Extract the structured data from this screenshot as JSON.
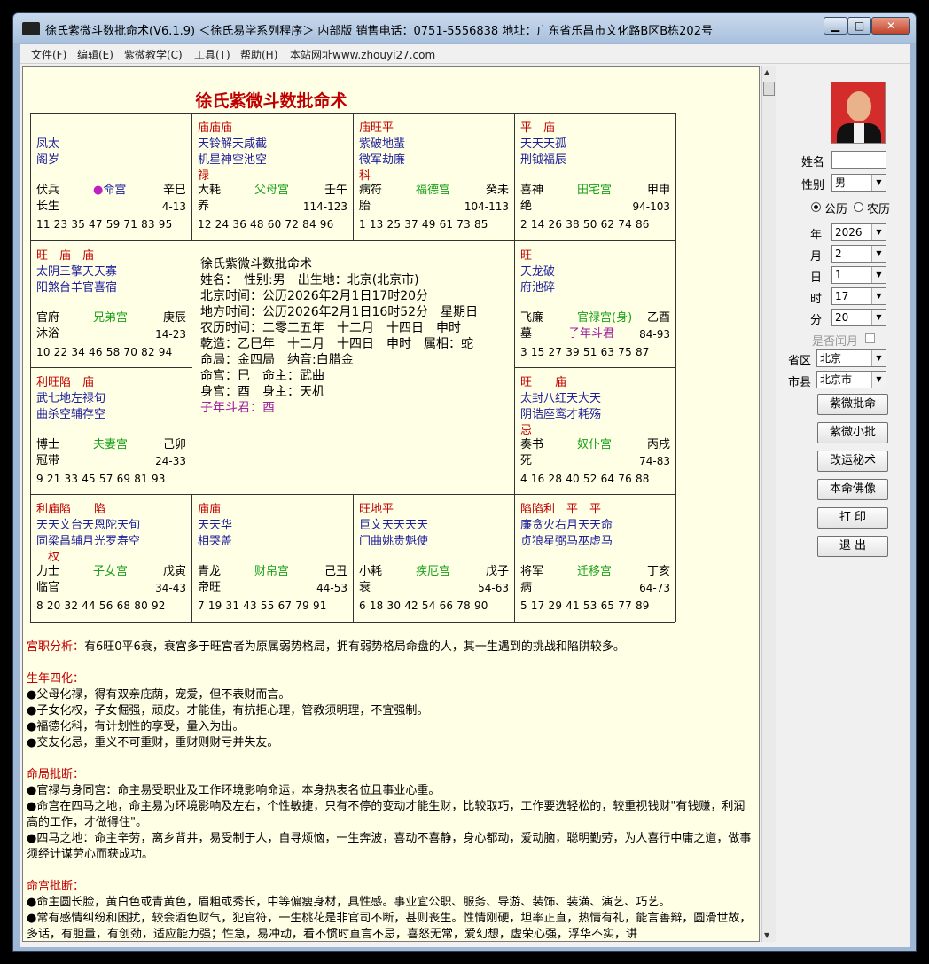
{
  "window": {
    "title": "徐氏紫微斗数批命术(V6.1.9) ＜徐氏易学系列程序＞ 内部版 销售电话：0751-5556838 地址：广东省乐昌市文化路B区B栋202号",
    "min": "▁",
    "max": "□",
    "close": "✕"
  },
  "menu": [
    "文件(F)",
    "编辑(E)",
    "紫微教学(C)",
    "工具(T)",
    "帮助(H)",
    "本站网址www.zhouyi27.com"
  ],
  "chart_title": "徐氏紫微斗数批命术",
  "cells": [
    {
      "id": "si",
      "lines": [
        "",
        "凤太",
        "阁岁",
        ""
      ],
      "god": "伏兵",
      "palace": "●命宫",
      "gz": "辛巳",
      "stage": "长生",
      "age": "4-13",
      "nums": "11 23 35 47 59 71 83 95"
    },
    {
      "id": "wu",
      "lines": [
        "庙庙庙",
        "天铃解天咸截",
        "机星神空池空",
        "禄"
      ],
      "god": "大耗",
      "palace": "父母宫",
      "gz": "壬午",
      "stage": "养",
      "age": "114-123",
      "nums": "12 24 36 48 60 72 84 96"
    },
    {
      "id": "wei",
      "lines": [
        "庙旺平",
        "紫破地蜚",
        "微军劫廉",
        "科"
      ],
      "god": "病符",
      "palace": "福德宫",
      "gz": "癸未",
      "stage": "胎",
      "age": "104-113",
      "nums": "1 13 25 37 49 61 73 85"
    },
    {
      "id": "shen",
      "lines": [
        "平　庙",
        "天天天孤",
        "刑钺福辰",
        ""
      ],
      "god": "喜神",
      "palace": "田宅宫",
      "gz": "甲申",
      "stage": "绝",
      "age": "94-103",
      "nums": "2 14 26 38 50 62 74 86"
    },
    {
      "id": "chen",
      "lines": [
        "旺　庙　庙",
        "太阴三擎天天寡",
        "阳煞台羊官喜宿",
        ""
      ],
      "god": "官府",
      "palace": "兄弟宫",
      "gz": "庚辰",
      "stage": "沐浴",
      "age": "14-23",
      "nums": "10 22 34 46 58 70 82 94"
    },
    {
      "id": "you",
      "lines": [
        "旺",
        "天龙破",
        "府池碎",
        ""
      ],
      "god": "飞廉",
      "palace": "官禄宫(身)",
      "gz": "乙酉",
      "stage": "墓",
      "age": "84-93",
      "nums": "3 15 27 39 51 63 75 87",
      "extra": "子年斗君"
    },
    {
      "id": "mao",
      "lines": [
        "利旺陷　庙",
        "武七地左禄旬",
        "曲杀空辅存空",
        ""
      ],
      "god": "博士",
      "palace": "夫妻宫",
      "gz": "己卯",
      "stage": "冠带",
      "age": "24-33",
      "nums": "9 21 33 45 57 69 81 93"
    },
    {
      "id": "xu",
      "lines": [
        "旺　　庙",
        "太封八红天大天",
        "阴诰座鸾才耗殇",
        "忌"
      ],
      "god": "奏书",
      "palace": "奴仆宫",
      "gz": "丙戌",
      "stage": "死",
      "age": "74-83",
      "nums": "4 16 28 40 52 64 76 88"
    },
    {
      "id": "yin",
      "lines": [
        "利庙陷　　陷",
        "天天文台天恩陀天旬",
        "同梁昌辅月光罗寿空",
        "　权"
      ],
      "god": "力士",
      "palace": "子女宫",
      "gz": "戊寅",
      "stage": "临官",
      "age": "34-43",
      "nums": "8 20 32 44 56 68 80 92"
    },
    {
      "id": "chou",
      "lines": [
        "庙庙",
        "天天华",
        "相哭盖",
        ""
      ],
      "god": "青龙",
      "palace": "财帛宫",
      "gz": "己丑",
      "stage": "帝旺",
      "age": "44-53",
      "nums": "7 19 31 43 55 67 79 91"
    },
    {
      "id": "zi",
      "lines": [
        "旺地平",
        "巨文天天天天",
        "门曲姚贵魁使",
        ""
      ],
      "god": "小耗",
      "palace": "疾厄宫",
      "gz": "戊子",
      "stage": "衰",
      "age": "54-63",
      "nums": "6 18 30 42 54 66 78 90"
    },
    {
      "id": "hai",
      "lines": [
        "陷陷利　平　平",
        "廉贪火右月天天命",
        "贞狼星弼马巫虚马",
        ""
      ],
      "god": "将军",
      "palace": "迁移宫",
      "gz": "丁亥",
      "stage": "病",
      "age": "64-73",
      "nums": "5 17 29 41 53 65 77 89"
    }
  ],
  "center": [
    "徐氏紫微斗数批命术",
    "姓名：　性别:男　出生地：北京(北京市)",
    "北京时间：公历2026年2月1日17时20分",
    "地方时间：公历2026年2月1日16时52分　星期日",
    "农历时间：二零二五年　十二月　十四日　申时",
    "乾造：乙巳年　十二月　十四日　申时　属相：蛇",
    "命局：金四局　纳音:白腊金",
    "命宫：巳　命主：武曲",
    "身宫：酉　身主：天机",
    "子年斗君：酉"
  ],
  "analysis": {
    "p1_head": "宫职分析：",
    "p1": "有6旺0平6衰，衰宫多于旺宫者为原属弱势格局，拥有弱势格局命盘的人，其一生遇到的挑战和陷阱较多。",
    "p2_head": "生年四化：",
    "p2": [
      "●父母化禄，得有双亲庇荫，宠爱，但不表财而言。",
      "●子女化权，子女倔强，顽皮。才能佳，有抗拒心理，管教须明理，不宜强制。",
      "●福德化科，有计划性的享受，量入为出。",
      "●交友化忌，重义不可重财，重财则财亏并失友。"
    ],
    "p3_head": "命局批断：",
    "p3": [
      "●官禄与身同宫：命主易受职业及工作环境影响命运，本身热衷名位且事业心重。",
      "●命宫在四马之地，命主易为环境影响及左右，个性敏捷，只有不停的变动才能生财，比较取巧，工作要选轻松的，较重视钱财\"有钱赚，利润高的工作，才做得住\"。",
      "●四马之地：命主辛劳，离乡背井，易受制于人，自寻烦恼，一生奔波，喜动不喜静，身心都动，爱动脑，聪明勤劳，为人喜行中庸之道，做事须经计谋劳心而获成功。"
    ],
    "p4_head": "命宫批断：",
    "p4": [
      "●命主圆长脸，黄白色或青黄色，眉粗或秀长，中等偏瘦身材，具性感。事业宜公职、服务、导游、装饰、装潢、演艺、巧艺。",
      "●常有感情纠纷和困扰，较会酒色财气，犯官符，一生桃花是非官司不断，甚则丧生。性情刚硬，坦率正直，热情有礼，能言善辩，圆滑世故，多话，有胆量，有创劲，适应能力强；性急，易冲动，看不惯时直言不忌，喜怒无常，爱幻想，虚荣心强，浮华不实，讲"
    ]
  },
  "side": {
    "name_label": "姓名",
    "name_value": "",
    "sex_label": "性别",
    "sex_value": "男",
    "cal_solar": "公历",
    "cal_lunar": "农历",
    "year_label": "年",
    "year": "2026",
    "month_label": "月",
    "month": "2",
    "day_label": "日",
    "day": "1",
    "hour_label": "时",
    "hour": "17",
    "min_label": "分",
    "minute": "20",
    "leap_label": "是否闰月",
    "prov_label": "省区",
    "prov": "北京",
    "city_label": "市县",
    "city": "北京市",
    "buttons": [
      "紫微批命",
      "紫微小批",
      "改运秘术",
      "本命佛像",
      "打 印",
      "退 出"
    ]
  }
}
